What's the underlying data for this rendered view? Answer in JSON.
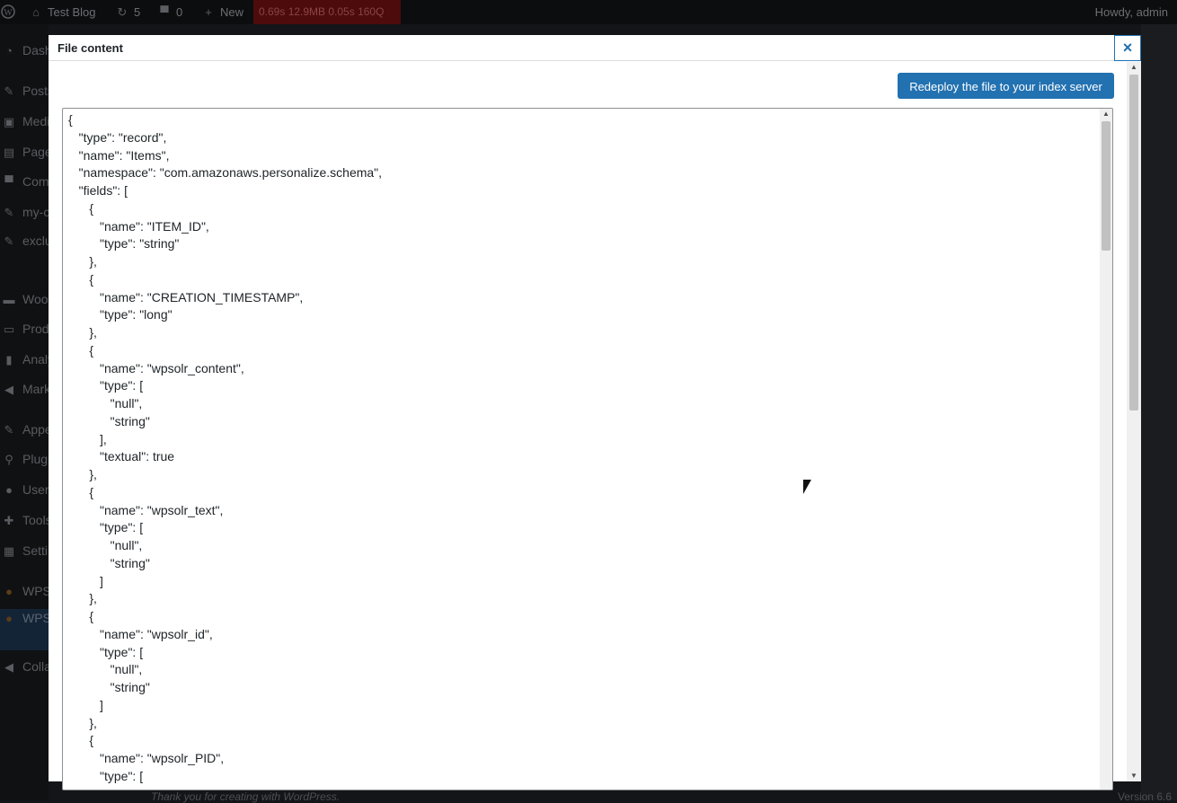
{
  "admin_bar": {
    "site_name": "Test Blog",
    "updates_count": "5",
    "comments_count": "0",
    "new_label": "New",
    "query_monitor": "0.69s  12.9MB  0.05s  160Q",
    "howdy": "Howdy, admin"
  },
  "admin_menu": {
    "items": [
      {
        "label": "Dashboard",
        "icon": "dashboard-icon"
      },
      {
        "label": "Posts",
        "icon": "pin-icon"
      },
      {
        "label": "Media",
        "icon": "media-icon"
      },
      {
        "label": "Pages",
        "icon": "pages-icon"
      },
      {
        "label": "Comments",
        "icon": "comment-icon"
      },
      {
        "label": "my-cpt",
        "icon": "pin-icon"
      },
      {
        "label": "exclude search",
        "icon": "pin-icon"
      },
      {
        "label": "WooCommerce",
        "icon": "woo-icon"
      },
      {
        "label": "Products",
        "icon": "products-icon"
      },
      {
        "label": "Analytics",
        "icon": "analytics-icon"
      },
      {
        "label": "Marketing",
        "icon": "megaphone-icon"
      },
      {
        "label": "Appearance",
        "icon": "appearance-icon"
      },
      {
        "label": "Plugins",
        "icon": "plugins-icon"
      },
      {
        "label": "Users",
        "icon": "users-icon"
      },
      {
        "label": "Tools",
        "icon": "tools-icon"
      },
      {
        "label": "Settings",
        "icon": "settings-icon"
      },
      {
        "label": "WPSOLR",
        "icon": "wpsolr-icon"
      },
      {
        "label": "WPSOLR ENTERPRISE",
        "icon": "wpsolr-icon"
      },
      {
        "label": "Collapse menu",
        "icon": "collapse-icon"
      }
    ]
  },
  "footer": {
    "thanks": "Thank you for creating with WordPress.",
    "version": "Version 6.6"
  },
  "modal": {
    "title": "File content",
    "close_symbol": "×",
    "redeploy_label": "Redeploy the file to your index server",
    "code_lines": [
      "{",
      "   \"type\": \"record\",",
      "   \"name\": \"Items\",",
      "   \"namespace\": \"com.amazonaws.personalize.schema\",",
      "   \"fields\": [",
      "      {",
      "         \"name\": \"ITEM_ID\",",
      "         \"type\": \"string\"",
      "      },",
      "      {",
      "         \"name\": \"CREATION_TIMESTAMP\",",
      "         \"type\": \"long\"",
      "      },",
      "      {",
      "         \"name\": \"wpsolr_content\",",
      "         \"type\": [",
      "            \"null\",",
      "            \"string\"",
      "         ],",
      "         \"textual\": true",
      "      },",
      "      {",
      "         \"name\": \"wpsolr_text\",",
      "         \"type\": [",
      "            \"null\",",
      "            \"string\"",
      "         ]",
      "      },",
      "      {",
      "         \"name\": \"wpsolr_id\",",
      "         \"type\": [",
      "            \"null\",",
      "            \"string\"",
      "         ]",
      "      },",
      "      {",
      "         \"name\": \"wpsolr_PID\",",
      "         \"type\": ["
    ]
  }
}
